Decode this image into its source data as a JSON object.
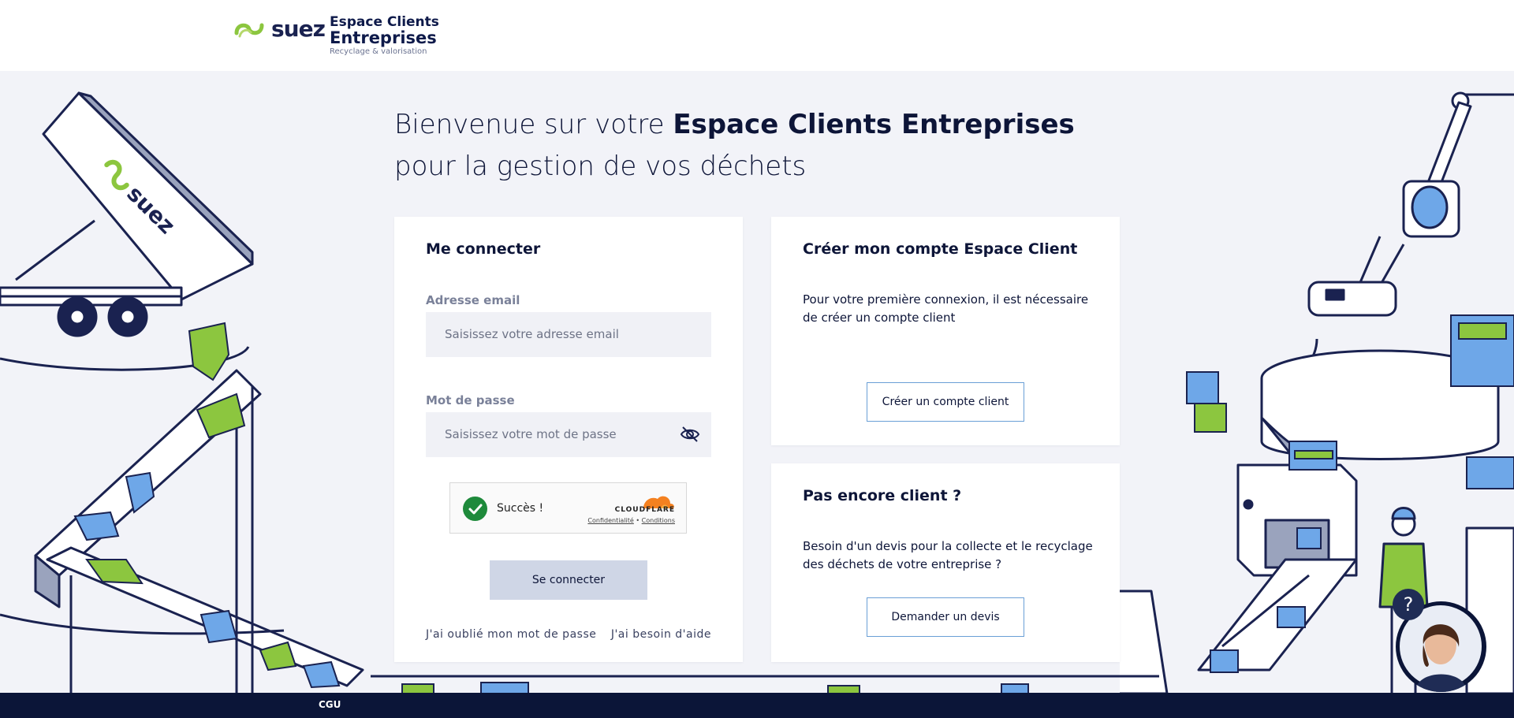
{
  "header": {
    "logo_word": "suez",
    "logo_title_1": "Espace Clients",
    "logo_title_2": "Entreprises",
    "logo_tagline": "Recyclage & valorisation"
  },
  "headline": {
    "line1_prefix": "Bienvenue sur votre ",
    "line1_bold": "Espace Clients Entreprises",
    "line2": "pour la gestion de vos déchets"
  },
  "login": {
    "title": "Me connecter",
    "email_label": "Adresse email",
    "email_placeholder": "Saisissez votre adresse email",
    "password_label": "Mot de passe",
    "password_placeholder": "Saisissez votre mot de passe",
    "captcha_status": "Succès !",
    "captcha_brand": "CLOUDFLARE",
    "captcha_privacy": "Confidentialité",
    "captcha_sep": "•",
    "captcha_terms": "Conditions",
    "submit_label": "Se connecter",
    "forgot_link": "J'ai oublié mon mot de passe",
    "help_link": "J'ai besoin d'aide"
  },
  "create_account": {
    "title": "Créer mon compte Espace Client",
    "body": "Pour votre première connexion, il est nécessaire de créer un compte client",
    "button_label": "Créer un compte client"
  },
  "quote": {
    "title": "Pas encore client ?",
    "body": "Besoin d'un devis pour la collecte et le recyclage des déchets de votre entreprise ?",
    "button_label": "Demander un devis"
  },
  "illustration": {
    "truck_brand": "suez"
  },
  "footer": {
    "cgu_label": "CGU"
  },
  "help": {
    "bubble_label": "?"
  },
  "colors": {
    "brand_green": "#8cc63f",
    "navy": "#0b1538",
    "button_disabled": "#cfd6e6",
    "outline_blue": "#6a9fd6",
    "success_green": "#1e8a3b",
    "cloudflare_orange": "#f48120"
  }
}
